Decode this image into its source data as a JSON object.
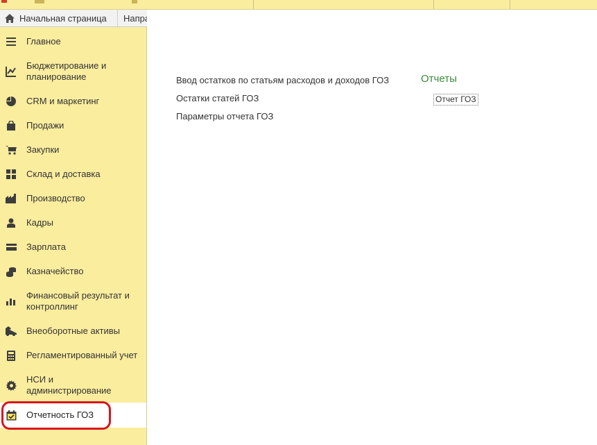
{
  "tabs": {
    "home_label": "Начальная страница",
    "next_label": "Напра"
  },
  "sidebar": {
    "items": [
      {
        "label": "Главное",
        "icon": "hamburger-icon"
      },
      {
        "label": "Бюджетирование и",
        "label2": "планирование",
        "icon": "budget-chart-icon"
      },
      {
        "label": "CRM и маркетинг",
        "icon": "pie-chart-icon"
      },
      {
        "label": "Продажи",
        "icon": "shopping-bag-icon"
      },
      {
        "label": "Закупки",
        "icon": "cart-icon"
      },
      {
        "label": "Склад и доставка",
        "icon": "warehouse-grid-icon"
      },
      {
        "label": "Производство",
        "icon": "factory-icon"
      },
      {
        "label": "Кадры",
        "icon": "person-icon"
      },
      {
        "label": "Зарплата",
        "icon": "wallet-icon"
      },
      {
        "label": "Казначейство",
        "icon": "coins-icon"
      },
      {
        "label": "Финансовый результат и",
        "label2": "контроллинг",
        "icon": "bar-chart-icon"
      },
      {
        "label": "Внеоборотные активы",
        "icon": "truck-icon"
      },
      {
        "label": "Регламентированный учет",
        "icon": "calculator-icon"
      },
      {
        "label": "НСИ и",
        "label2": "администрирование",
        "icon": "gear-icon"
      },
      {
        "label": "Отчетность ГОЗ",
        "icon": "calendar-check-icon"
      }
    ]
  },
  "main": {
    "links": [
      "Ввод остатков по статьям расходов и доходов ГОЗ",
      "Остатки статей ГОЗ",
      "Параметры отчета ГОЗ"
    ],
    "reports_title": "Отчеты",
    "reports": [
      "Отчет ГОЗ"
    ]
  },
  "colors": {
    "sidebar_bg": "#fbed9e",
    "section_title": "#3a8a3a",
    "highlight": "#d9141b"
  }
}
